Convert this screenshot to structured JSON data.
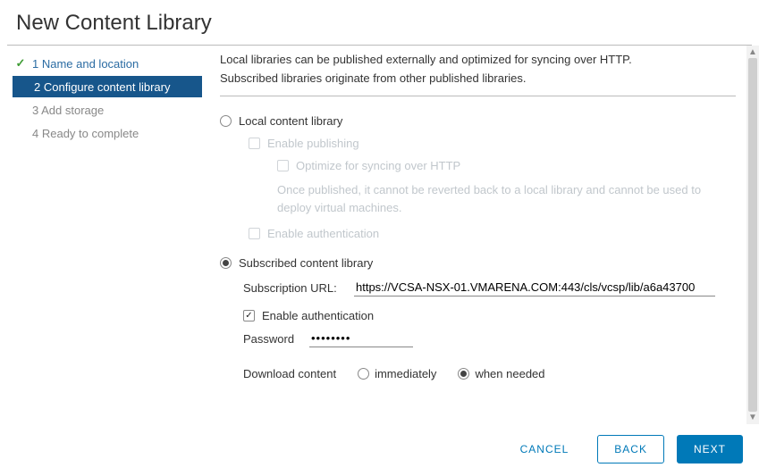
{
  "dialog": {
    "title": "New Content Library"
  },
  "steps": [
    {
      "label": "1 Name and location",
      "state": "done"
    },
    {
      "label": "2 Configure content library",
      "state": "active"
    },
    {
      "label": "3 Add storage",
      "state": "pending"
    },
    {
      "label": "4 Ready to complete",
      "state": "pending"
    }
  ],
  "intro": {
    "line1": "Local libraries can be published externally and optimized for syncing over HTTP.",
    "line2": "Subscribed libraries originate from other published libraries."
  },
  "local": {
    "label": "Local content library",
    "enable_publishing": "Enable publishing",
    "optimize": "Optimize for syncing over HTTP",
    "optimize_note": "Once published, it cannot be reverted back to a local library and cannot be used to deploy virtual machines.",
    "enable_auth": "Enable authentication"
  },
  "subscribed": {
    "label": "Subscribed content library",
    "url_label": "Subscription URL:",
    "url_value": "https://VCSA-NSX-01.VMARENA.COM:443/cls/vcsp/lib/a6a43700",
    "enable_auth": "Enable authentication",
    "password_label": "Password",
    "password_value": "••••••••",
    "download_label": "Download content",
    "download_immediately": "immediately",
    "download_when_needed": "when needed"
  },
  "buttons": {
    "cancel": "CANCEL",
    "back": "BACK",
    "next": "NEXT"
  }
}
